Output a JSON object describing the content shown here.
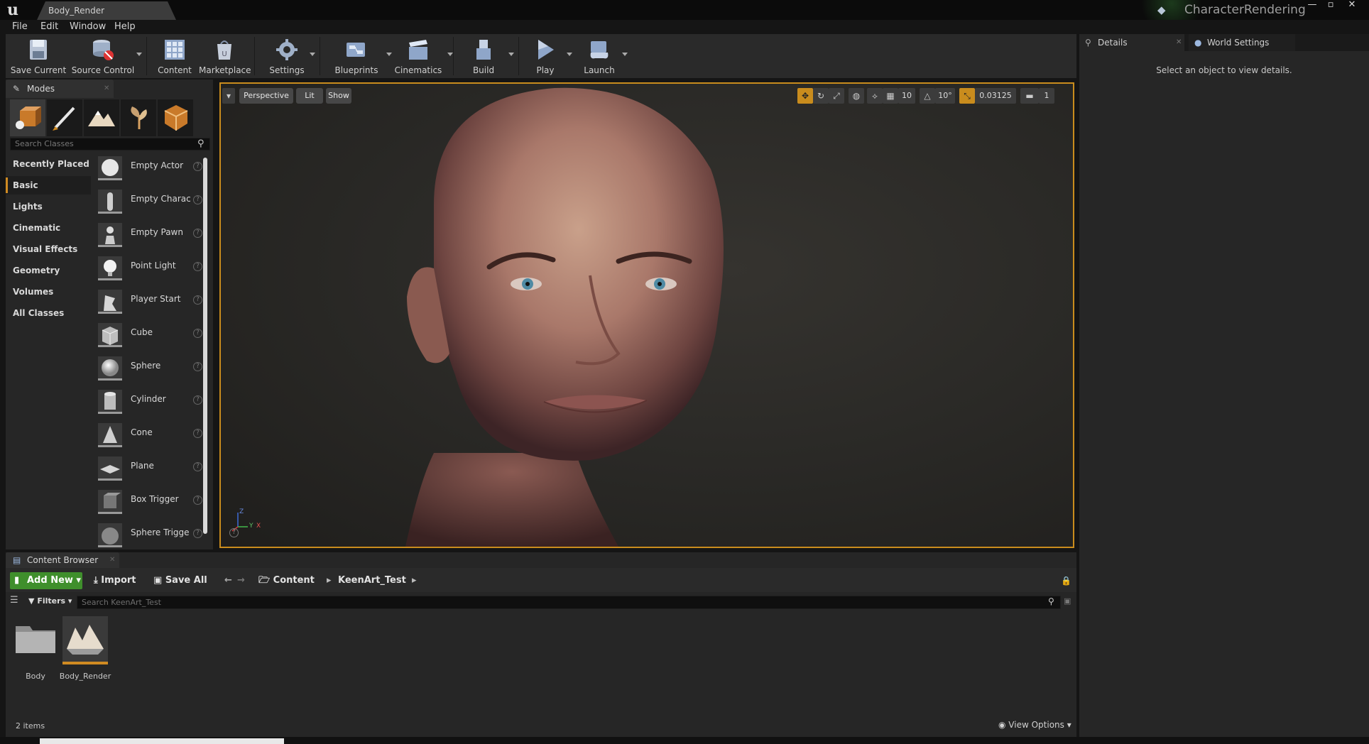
{
  "window": {
    "doc_tab": "Body_Render",
    "project_name": "CharacterRendering",
    "minimize": "—",
    "restore": "▫",
    "close": "✕"
  },
  "menu": [
    "File",
    "Edit",
    "Window",
    "Help"
  ],
  "toolbar": {
    "save_current": "Save Current",
    "source_control": "Source Control",
    "content": "Content",
    "marketplace": "Marketplace",
    "settings": "Settings",
    "blueprints": "Blueprints",
    "cinematics": "Cinematics",
    "build": "Build",
    "play": "Play",
    "launch": "Launch"
  },
  "right_panel": {
    "details_tab": "Details",
    "world_settings_tab": "World Settings",
    "message": "Select an object to view details."
  },
  "modes": {
    "tab": "Modes",
    "search_placeholder": "Search Classes",
    "categories": [
      "Recently Placed",
      "Basic",
      "Lights",
      "Cinematic",
      "Visual Effects",
      "Geometry",
      "Volumes",
      "All Classes"
    ],
    "active_category": "Basic",
    "classes": [
      "Empty Actor",
      "Empty Charac",
      "Empty Pawn",
      "Point Light",
      "Player Start",
      "Cube",
      "Sphere",
      "Cylinder",
      "Cone",
      "Plane",
      "Box Trigger",
      "Sphere Trigge"
    ],
    "help": "?"
  },
  "viewport": {
    "perspective": "Perspective",
    "lit": "Lit",
    "show": "Show",
    "grid_snap": "10",
    "rotation_snap": "10°",
    "scale_snap": "0.03125",
    "camera_speed": "1",
    "axis_z": "Z",
    "axis_y": "Y",
    "axis_x": "X"
  },
  "content_browser": {
    "tab": "Content Browser",
    "add_new": "Add New",
    "import": "Import",
    "save_all": "Save All",
    "path": [
      "Content",
      "KeenArt_Test"
    ],
    "filters": "Filters",
    "search_placeholder": "Search KeenArt_Test",
    "assets": [
      "Body",
      "Body_Render"
    ],
    "item_count": "2 items",
    "view_options": "View Options"
  },
  "colors": {
    "accent_orange": "#c98c1d",
    "add_new_green": "#3f8f2c",
    "panel": "#262626"
  }
}
